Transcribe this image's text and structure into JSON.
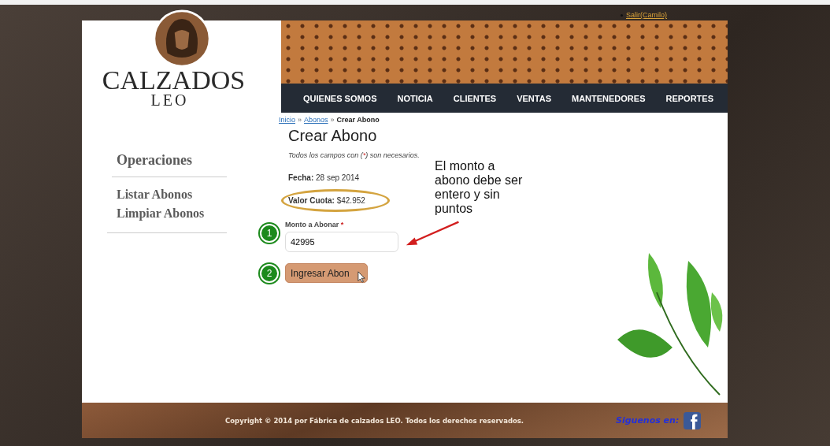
{
  "account": {
    "link": "Salir(Camilo)"
  },
  "logo": {
    "title": "CALZADOS",
    "subtitle": "LEO"
  },
  "nav": [
    "QUIENES SOMOS",
    "NOTICIA",
    "CLIENTES",
    "VENTAS",
    "MANTENEDORES",
    "REPORTES"
  ],
  "sidebar": {
    "title": "Operaciones",
    "items": [
      "Listar Abonos",
      "Limpiar Abonos"
    ]
  },
  "breadcrumb": {
    "separator": "»",
    "items": [
      {
        "label": "Inicio",
        "link": true
      },
      {
        "label": "Abonos",
        "link": true
      },
      {
        "label": "Crear Abono",
        "link": false
      }
    ]
  },
  "page_title": "Crear Abono",
  "note": {
    "before": "Todos los campos con (",
    "mark": "*",
    "after": ") son necesarios."
  },
  "details": [
    {
      "label": "Fecha:",
      "value": "28 sep 2014",
      "highlighted": false
    },
    {
      "label": "Valor Cuota:",
      "value": "$42.952",
      "highlighted": true
    }
  ],
  "form": {
    "label": "Monto a Abonar",
    "mark": "*",
    "value": "42995",
    "step": "1"
  },
  "submit": {
    "label": "Ingresar Abon",
    "step": "2"
  },
  "callout": "El monto a abono debe ser entero y sin puntos",
  "footer": {
    "copyright": "Copyright © 2014 por Fábrica de calzados LEO. Todos los derechos reservados.",
    "follow": "Siguenos en:"
  }
}
